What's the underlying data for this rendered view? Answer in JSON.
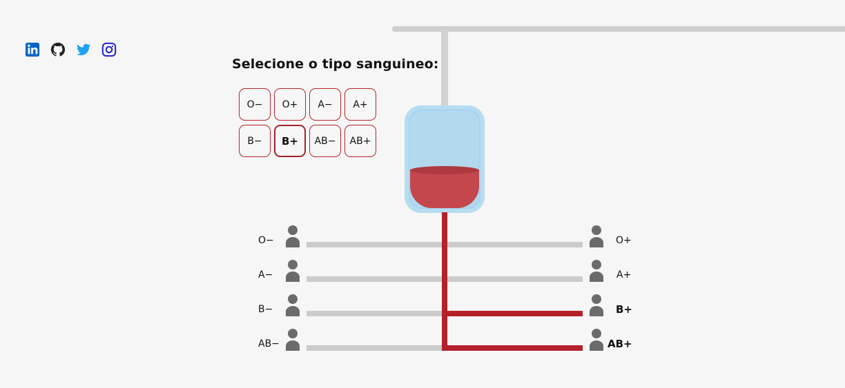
{
  "social": [
    {
      "name": "linkedin-icon",
      "color": "#0a66c2"
    },
    {
      "name": "github-icon",
      "color": "#222222"
    },
    {
      "name": "twitter-icon",
      "color": "#1da1f2"
    },
    {
      "name": "instagram-icon",
      "color": "#2323c9"
    }
  ],
  "selector": {
    "title": "Selecione o tipo sanguineo:",
    "types": [
      "O−",
      "O+",
      "A−",
      "A+",
      "B−",
      "B+",
      "AB−",
      "AB+"
    ],
    "selected": "B+"
  },
  "recipients": {
    "left": [
      "O−",
      "A−",
      "B−",
      "AB−"
    ],
    "right": [
      "O+",
      "A+",
      "B+",
      "AB+"
    ],
    "compatible": [
      "B+",
      "AB+"
    ]
  },
  "colors": {
    "blood": "#b5202a",
    "accent": "#b5232b",
    "bag": "#a9d3ec"
  }
}
